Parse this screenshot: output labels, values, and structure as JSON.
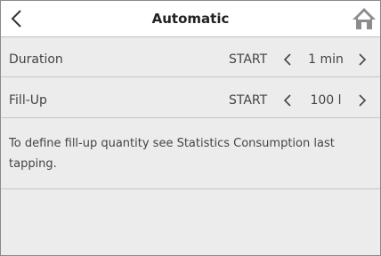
{
  "header": {
    "title": "Automatic",
    "back_icon": "chevron-left-icon",
    "home_icon": "home-icon"
  },
  "rows": [
    {
      "label": "Duration",
      "start_label": "START",
      "value": "1 min"
    },
    {
      "label": "Fill-Up",
      "start_label": "START",
      "value": "100 l"
    }
  ],
  "info": {
    "text": "To define fill-up quantity see Statistics Consumption last tapping."
  },
  "colors": {
    "background": "#ececec",
    "header_background": "#ffffff",
    "divider": "#c4c4c4",
    "text": "#444444"
  }
}
